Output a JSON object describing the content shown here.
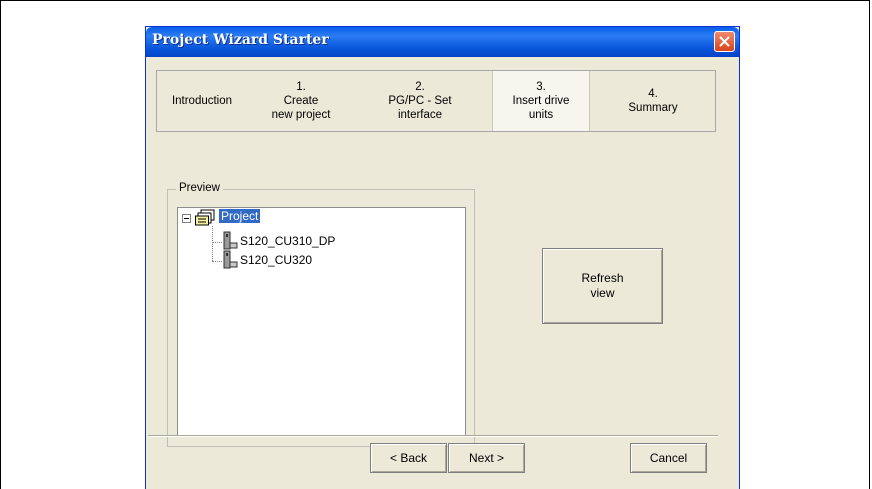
{
  "window": {
    "title": "Project Wizard Starter"
  },
  "tabs": [
    {
      "line1": "Introduction",
      "line2": "",
      "line3": ""
    },
    {
      "line1": "1.",
      "line2": "Create",
      "line3": "new project"
    },
    {
      "line1": "2.",
      "line2": "PG/PC - Set",
      "line3": "interface"
    },
    {
      "line1": "3.",
      "line2": "Insert drive",
      "line3": "units"
    },
    {
      "line1": "4.",
      "line2": "Summary",
      "line3": ""
    }
  ],
  "active_tab_index": 3,
  "preview": {
    "label": "Preview",
    "tree": {
      "root": "Project",
      "children": [
        "S120_CU310_DP",
        "S120_CU320"
      ]
    }
  },
  "buttons": {
    "refresh": "Refresh view",
    "back": "< Back",
    "next": "Next >",
    "cancel": "Cancel"
  },
  "colors": {
    "titlebar": "#0a5ee8",
    "selection": "#316ac5",
    "face": "#ece9d8"
  }
}
